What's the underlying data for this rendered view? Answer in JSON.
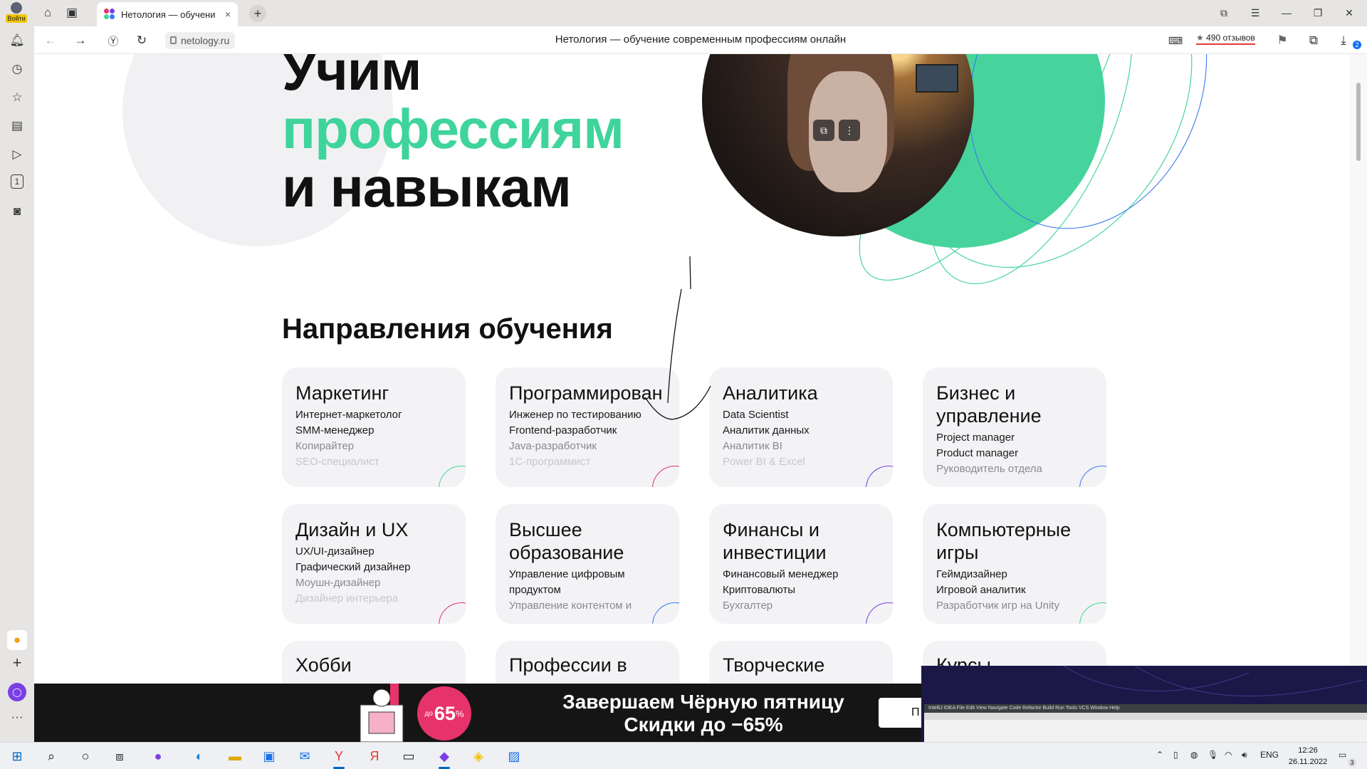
{
  "browser": {
    "profile_label": "Войти",
    "tab_title": "Нетология — обучени",
    "tab_close": "×",
    "new_tab": "+",
    "domain": "netology.ru",
    "page_title": "Нетология — обучение современным профессиям онлайн",
    "reviews": "490 отзывов",
    "reviews_star": "★",
    "download_count": "2",
    "tab_counter": "1"
  },
  "hero": {
    "line1": "Учим",
    "line2": "профессиям",
    "line3": "и навыкам"
  },
  "section_title": "Направления обучения",
  "cards": [
    {
      "title": "Маркетинг",
      "items": [
        "Интернет-маркетолог",
        "SMM-менеджер",
        "Копирайтер",
        "SEO-специалист"
      ],
      "accent": "#46d49c"
    },
    {
      "title": "Программирован",
      "items": [
        "Инженер по тестированию",
        "Frontend-разработчик",
        "Java-разработчик",
        "1С-программист"
      ],
      "accent": "#e7336b"
    },
    {
      "title": "Аналитика",
      "items": [
        "Data Scientist",
        "Аналитик данных",
        "Аналитик BI",
        "Power BI & Excel"
      ],
      "accent": "#7b3fe4"
    },
    {
      "title": "Бизнес и\nуправление",
      "items": [
        "Project manager",
        "Product manager",
        "Руководитель отдела"
      ],
      "accent": "#3a7bf0"
    },
    {
      "title": "Дизайн и UX",
      "items": [
        "UX/UI-дизайнер",
        "Графический дизайнер",
        "Моушн-дизайнер",
        "Дизайнер интерьера"
      ],
      "accent": "#e7336b"
    },
    {
      "title": "Высшее\nобразование",
      "items": [
        "Управление цифровым",
        "продуктом",
        "Управление контентом и"
      ],
      "accent": "#3a7bf0"
    },
    {
      "title": "Финансы и\nинвестиции",
      "items": [
        "Финансовый менеджер",
        "Криптовалюты",
        "Бухгалтер"
      ],
      "accent": "#7b3fe4"
    },
    {
      "title": "Компьютерные\nигры",
      "items": [
        "Геймдизайнер",
        "Игровой аналитик",
        "Разработчик игр на Unity"
      ],
      "accent": "#46d49c"
    },
    {
      "title": "Хобби",
      "items": [],
      "accent": "#46d49c"
    },
    {
      "title": "Профессии в",
      "items": [],
      "accent": "#3a7bf0"
    },
    {
      "title": "Творческие",
      "items": [],
      "accent": "#7b3fe4"
    },
    {
      "title": "Курсы",
      "items": [],
      "accent": "#46d49c"
    }
  ],
  "promo": {
    "badge_prefix": "до",
    "badge_value": "65",
    "badge_suffix": "%",
    "line1": "Завершаем Чёрную пятницу",
    "line2": "Скидки до −65%",
    "cta_visible": "П"
  },
  "pip_window": {
    "menu": "IntelliJ IDEA   File   Edit   View   Navigate   Code   Refactor   Build   Run   Tools   VCS   Window   Help"
  },
  "taskbar": {
    "language": "ENG",
    "time": "12:26",
    "date": "26.11.2022",
    "notifications": "3"
  },
  "colors": {
    "brand_green": "#3fd49b",
    "brand_green_disc": "#46d49c",
    "promo_pink": "#e7336b",
    "reviews_underline": "#e53935"
  }
}
